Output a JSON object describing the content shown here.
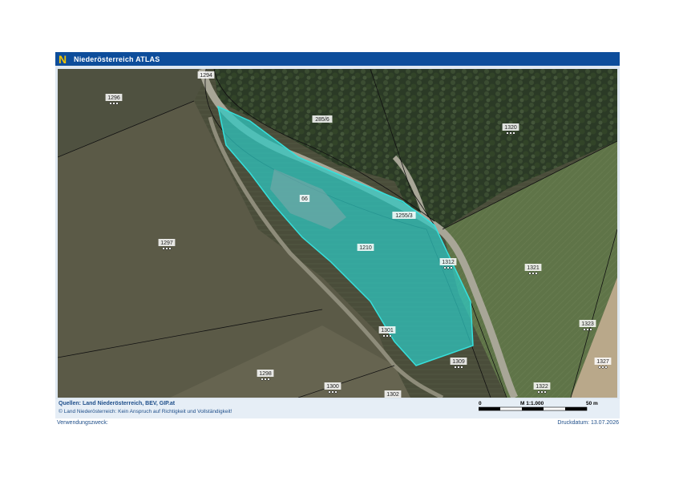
{
  "header": {
    "logo_letter": "N",
    "title": "Niederösterreich ATLAS"
  },
  "colors": {
    "header_bg": "#0d4d9b",
    "logo_yellow": "#f2c300",
    "selection_fill": "#2ec9c4",
    "selection_stroke": "#36e0dc"
  },
  "map": {
    "parcels": [
      {
        "id": "1294"
      },
      {
        "id": "1296"
      },
      {
        "id": "285/6"
      },
      {
        "id": "1320"
      },
      {
        "id": "66"
      },
      {
        "id": "1255/3"
      },
      {
        "id": "1297"
      },
      {
        "id": "1210"
      },
      {
        "id": "1312"
      },
      {
        "id": "1321"
      },
      {
        "id": "1323"
      },
      {
        "id": "1327"
      },
      {
        "id": "1301"
      },
      {
        "id": "1309"
      },
      {
        "id": "1298"
      },
      {
        "id": "1300"
      },
      {
        "id": "1322"
      },
      {
        "id": "1302"
      }
    ]
  },
  "footer": {
    "sources": "Quellen: Land Niederösterreich, BEV, GIP.at",
    "disclaimer": "© Land Niederösterreich: Kein Anspruch auf Richtigkeit und Vollständigkeit!"
  },
  "scale": {
    "start": "0",
    "ratio": "M 1:1.000",
    "end": "50 m"
  },
  "meta": {
    "purpose": "Verwendungszweck:",
    "print_date": "Druckdatum: 13.07.2026"
  }
}
